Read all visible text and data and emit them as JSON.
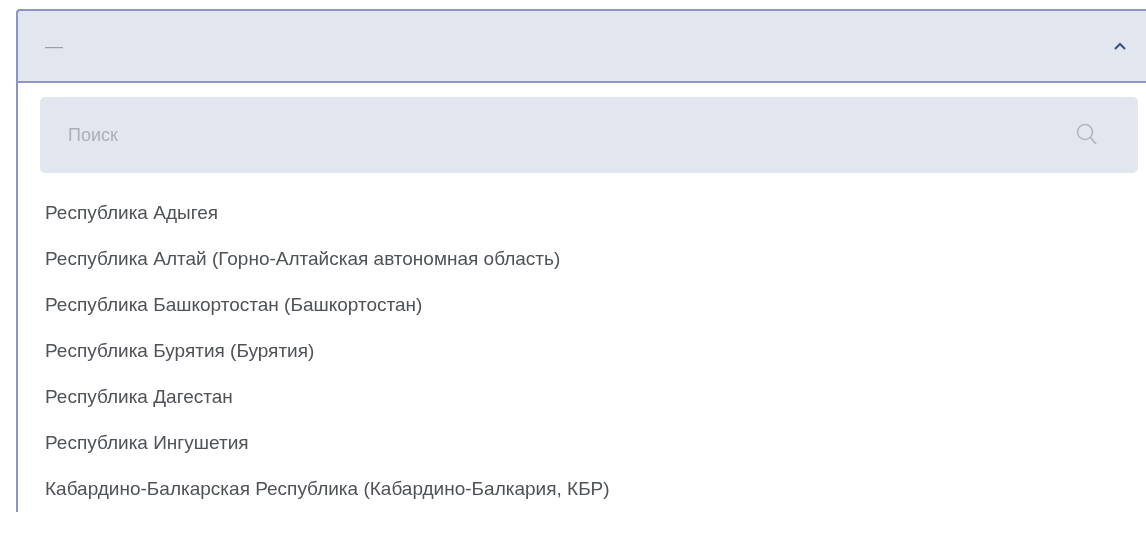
{
  "select": {
    "value": "—",
    "expanded": true
  },
  "search": {
    "placeholder": "Поиск"
  },
  "options": [
    {
      "label": "Республика Адыгея"
    },
    {
      "label": "Республика Алтай (Горно-Алтайская автономная область)"
    },
    {
      "label": "Республика Башкортостан (Башкортостан)"
    },
    {
      "label": "Республика Бурятия (Бурятия)"
    },
    {
      "label": "Республика Дагестан"
    },
    {
      "label": "Республика Ингушетия"
    },
    {
      "label": "Кабардино-Балкарская Республика (Кабардино-Балкария, КБР)"
    }
  ]
}
